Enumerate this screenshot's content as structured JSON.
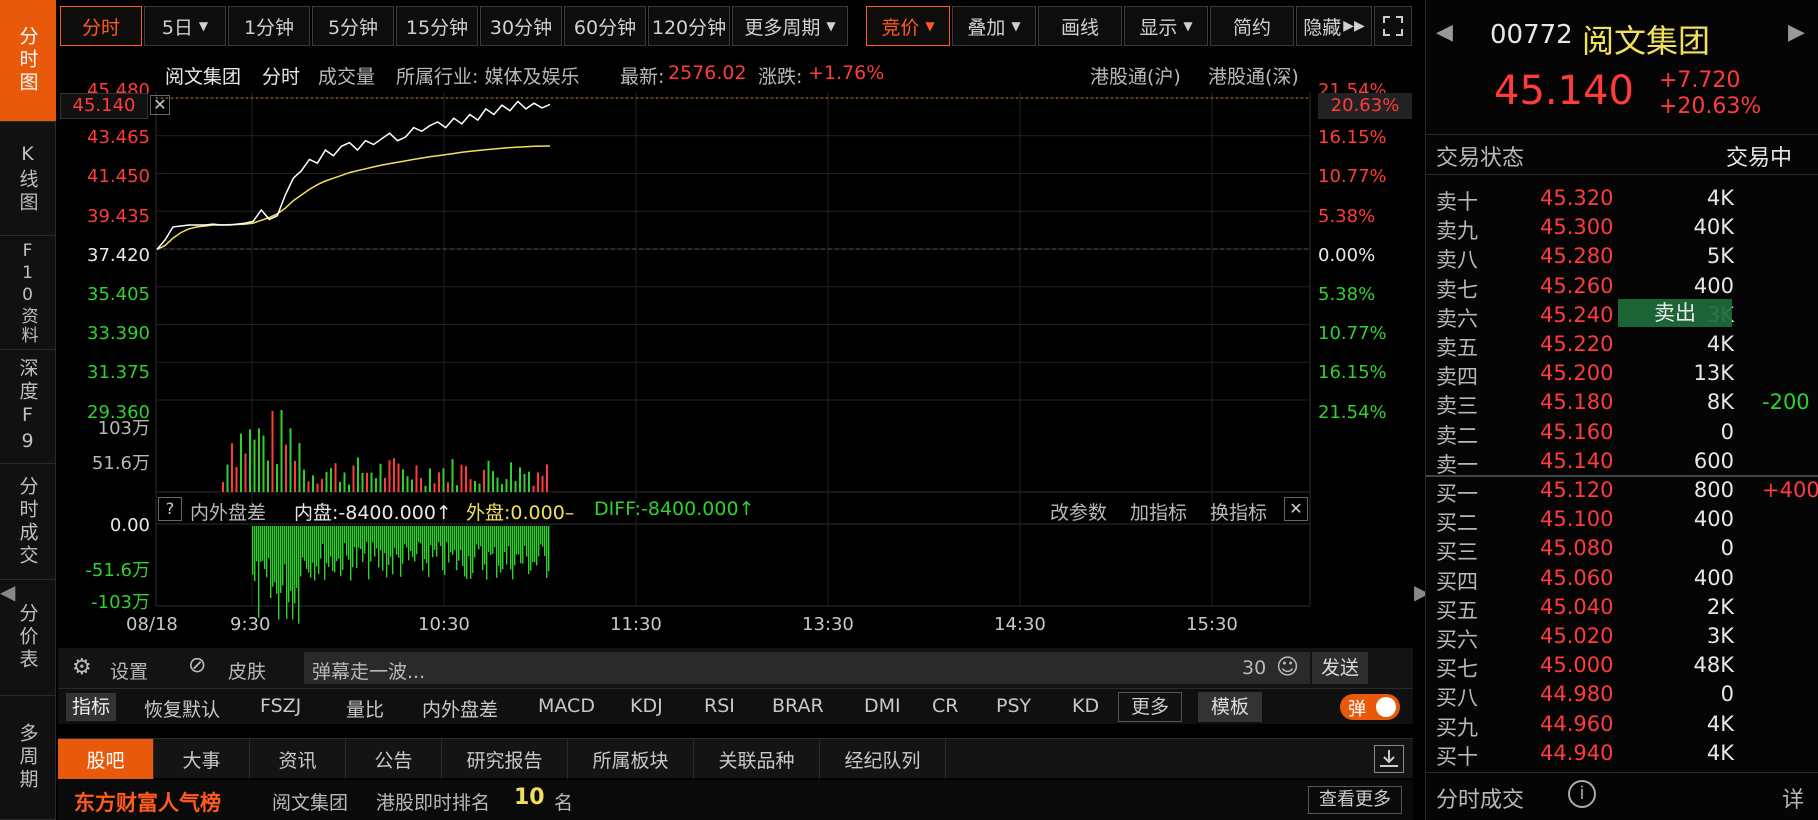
{
  "leftnav": [
    {
      "label": "分时图",
      "active": true
    },
    {
      "label": "K线图",
      "active": false
    },
    {
      "label": "F10资料",
      "active": false
    },
    {
      "label": "深度F9",
      "active": false
    },
    {
      "label": "分时成交",
      "active": false
    },
    {
      "label": "分价表",
      "active": false
    },
    {
      "label": "多周期",
      "active": false
    }
  ],
  "toolbar": {
    "periods": [
      "分时",
      "5日",
      "1分钟",
      "5分钟",
      "15分钟",
      "30分钟",
      "60分钟",
      "120分钟",
      "更多周期"
    ],
    "tools": [
      "竞价",
      "叠加",
      "画线",
      "显示",
      "简约",
      "隐藏"
    ]
  },
  "info": {
    "name": "阅文集团",
    "mode": "分时",
    "volume_label": "成交量",
    "industry": "所属行业: 媒体及娱乐",
    "latest_label": "最新:",
    "latest_value": "2576.02",
    "change_label": "涨跌:",
    "change_value": "+1.76%",
    "connect_sh": "港股通(沪)",
    "connect_sz": "港股通(深)"
  },
  "cursor_price": "45.140",
  "cursor_pct": "20.63%",
  "chart_data": {
    "type": "line",
    "price_axis": [
      "45.480",
      "43.465",
      "41.450",
      "39.435",
      "37.420",
      "35.405",
      "33.390",
      "31.375",
      "29.360"
    ],
    "pct_axis": [
      "21.54%",
      "16.15%",
      "10.77%",
      "5.38%",
      "0.00%",
      "5.38%",
      "10.77%",
      "16.15%",
      "21.54%"
    ],
    "ylim": [
      29.36,
      45.48
    ],
    "pre_close": 37.42,
    "x_labels": [
      "08/18",
      "9:30",
      "10:30",
      "11:30",
      "13:30",
      "14:30",
      "15:30"
    ],
    "series": [
      {
        "values": [
          37.4,
          37.9,
          38.6,
          38.65,
          38.7,
          38.7,
          38.7,
          38.75,
          38.7,
          38.7,
          38.75,
          38.8,
          38.9,
          39.5,
          39.0,
          39.2,
          40.3,
          41.2,
          41.6,
          42.2,
          42.0,
          42.7,
          42.4,
          42.9,
          43.1,
          42.7,
          43.2,
          43.0,
          43.3,
          43.6,
          43.2,
          43.4,
          43.9,
          43.7,
          44.0,
          44.2,
          43.9,
          44.4,
          44.1,
          44.6,
          44.3,
          44.9,
          44.6,
          45.1,
          44.8,
          45.3,
          44.9,
          45.2,
          44.95,
          45.14
        ]
      },
      {
        "values": [
          37.4,
          37.6,
          38.0,
          38.3,
          38.5,
          38.6,
          38.65,
          38.7,
          38.7,
          38.72,
          38.73,
          38.75,
          38.8,
          38.95,
          39.1,
          39.3,
          39.6,
          40.0,
          40.3,
          40.6,
          40.85,
          41.05,
          41.2,
          41.35,
          41.5,
          41.6,
          41.7,
          41.8,
          41.9,
          41.98,
          42.05,
          42.12,
          42.2,
          42.27,
          42.34,
          42.4,
          42.46,
          42.52,
          42.58,
          42.63,
          42.68,
          42.72,
          42.76,
          42.8,
          42.83,
          42.86,
          42.88,
          42.9,
          42.91,
          42.92
        ]
      }
    ],
    "volume_axis": [
      "103万",
      "51.6万"
    ],
    "flow_axis": [
      "0.00",
      "-51.6万",
      "-103万"
    ]
  },
  "flow_header": {
    "help": "?",
    "title": "内外盘差",
    "inner": "内盘:-8400.000↑",
    "outer": "外盘:0.000–",
    "diff": "DIFF:-8400.000↑",
    "actions": [
      "改参数",
      "加指标",
      "换指标"
    ]
  },
  "comment": {
    "settings": "设置",
    "skin": "皮肤",
    "placeholder": "弹幕走一波...",
    "count": "30",
    "send": "发送"
  },
  "indicators": {
    "label": "指标",
    "items": [
      "恢复默认",
      "FSZJ",
      "量比",
      "内外盘差",
      "MACD",
      "KDJ",
      "RSI",
      "BRAR",
      "DMI",
      "CR",
      "PSY",
      "KD"
    ],
    "more": "更多",
    "template": "模板",
    "toggle": "弹"
  },
  "tabs": [
    "股吧",
    "大事",
    "资讯",
    "公告",
    "研究报告",
    "所属板块",
    "关联品种",
    "经纪队列"
  ],
  "rank": {
    "brand": "东方财富人气榜",
    "name": "阅文集团",
    "label": "港股即时排名",
    "num": "10",
    "unit": "名",
    "more": "查看更多"
  },
  "quote": {
    "code": "00772",
    "name": "阅文集团",
    "price": "45.140",
    "change": "+7.720",
    "pct": "+20.63%",
    "status_label": "交易状态",
    "status_value": "交易中"
  },
  "orderbook": {
    "asks": [
      {
        "label": "卖十",
        "price": "45.320",
        "vol": "4K",
        "delta": ""
      },
      {
        "label": "卖九",
        "price": "45.300",
        "vol": "40K",
        "delta": ""
      },
      {
        "label": "卖八",
        "price": "45.280",
        "vol": "5K",
        "delta": ""
      },
      {
        "label": "卖七",
        "price": "45.260",
        "vol": "400",
        "delta": ""
      },
      {
        "label": "卖六",
        "price": "45.240",
        "vol": "3K",
        "delta": ""
      },
      {
        "label": "卖五",
        "price": "45.220",
        "vol": "4K",
        "delta": ""
      },
      {
        "label": "卖四",
        "price": "45.200",
        "vol": "13K",
        "delta": ""
      },
      {
        "label": "卖三",
        "price": "45.180",
        "vol": "8K",
        "delta": "-200"
      },
      {
        "label": "卖二",
        "price": "45.160",
        "vol": "0",
        "delta": ""
      },
      {
        "label": "卖一",
        "price": "45.140",
        "vol": "600",
        "delta": ""
      }
    ],
    "bids": [
      {
        "label": "买一",
        "price": "45.120",
        "vol": "800",
        "delta": "+400"
      },
      {
        "label": "买二",
        "price": "45.100",
        "vol": "400",
        "delta": ""
      },
      {
        "label": "买三",
        "price": "45.080",
        "vol": "0",
        "delta": ""
      },
      {
        "label": "买四",
        "price": "45.060",
        "vol": "400",
        "delta": ""
      },
      {
        "label": "买五",
        "price": "45.040",
        "vol": "2K",
        "delta": ""
      },
      {
        "label": "买六",
        "price": "45.020",
        "vol": "3K",
        "delta": ""
      },
      {
        "label": "买七",
        "price": "45.000",
        "vol": "48K",
        "delta": ""
      },
      {
        "label": "买八",
        "price": "44.980",
        "vol": "0",
        "delta": ""
      },
      {
        "label": "买九",
        "price": "44.960",
        "vol": "4K",
        "delta": ""
      },
      {
        "label": "买十",
        "price": "44.940",
        "vol": "4K",
        "delta": ""
      }
    ],
    "sell_button": "卖出"
  },
  "footer": {
    "label": "分时成交",
    "detail": "详"
  },
  "colors": {
    "accent": "#e8590c",
    "up": "#ff3b3b",
    "down": "#2fd12f",
    "avg": "#f1e15a"
  }
}
